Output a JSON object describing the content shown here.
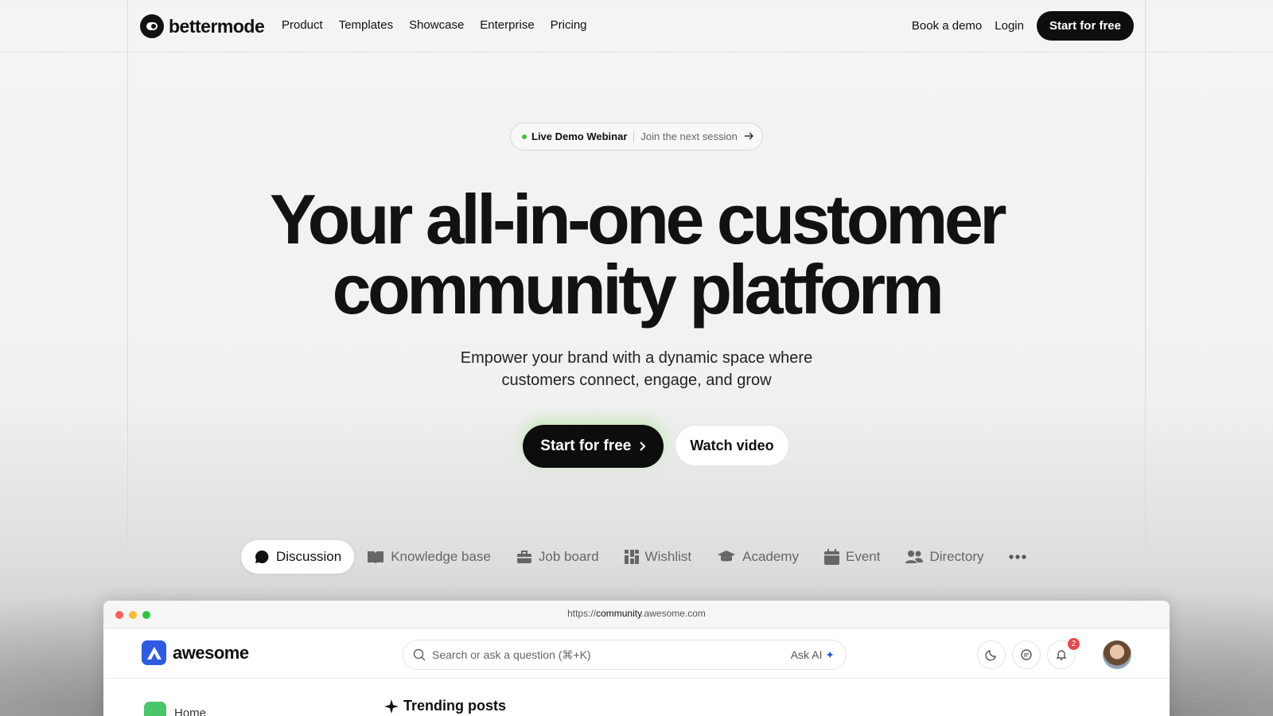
{
  "nav": {
    "logo_text": "bettermode",
    "links": [
      "Product",
      "Templates",
      "Showcase",
      "Enterprise",
      "Pricing"
    ],
    "book_demo": "Book a demo",
    "login": "Login",
    "start_free": "Start for free"
  },
  "webinar": {
    "label": "Live Demo Webinar",
    "cta": "Join the next session"
  },
  "hero": {
    "title_line1": "Your all-in-one customer",
    "title_line2": "community platform",
    "subtitle_line1": "Empower your brand with a dynamic space where",
    "subtitle_line2": "customers connect, engage, and grow",
    "primary_cta": "Start for free",
    "secondary_cta": "Watch video"
  },
  "tabs": [
    {
      "label": "Discussion",
      "icon": "chat-bubble-icon",
      "active": true
    },
    {
      "label": "Knowledge base",
      "icon": "book-icon",
      "active": false
    },
    {
      "label": "Job board",
      "icon": "briefcase-icon",
      "active": false
    },
    {
      "label": "Wishlist",
      "icon": "grid-icon",
      "active": false
    },
    {
      "label": "Academy",
      "icon": "graduation-cap-icon",
      "active": false
    },
    {
      "label": "Event",
      "icon": "calendar-icon",
      "active": false
    },
    {
      "label": "Directory",
      "icon": "people-icon",
      "active": false
    }
  ],
  "browser": {
    "url_prefix": "https://",
    "url_host": "community",
    "url_suffix": ".awesome.com",
    "app_name": "awesome",
    "search_placeholder": "Search or ask a question (⌘+K)",
    "ask_ai": "Ask AI",
    "notification_count": "2",
    "sidebar_home": "Home",
    "section_title": "Trending posts"
  },
  "colors": {
    "accent_dark": "#0d0d0d",
    "app_brand": "#2d5be3",
    "live_dot": "#3fbf3f",
    "badge": "#e5484d"
  }
}
